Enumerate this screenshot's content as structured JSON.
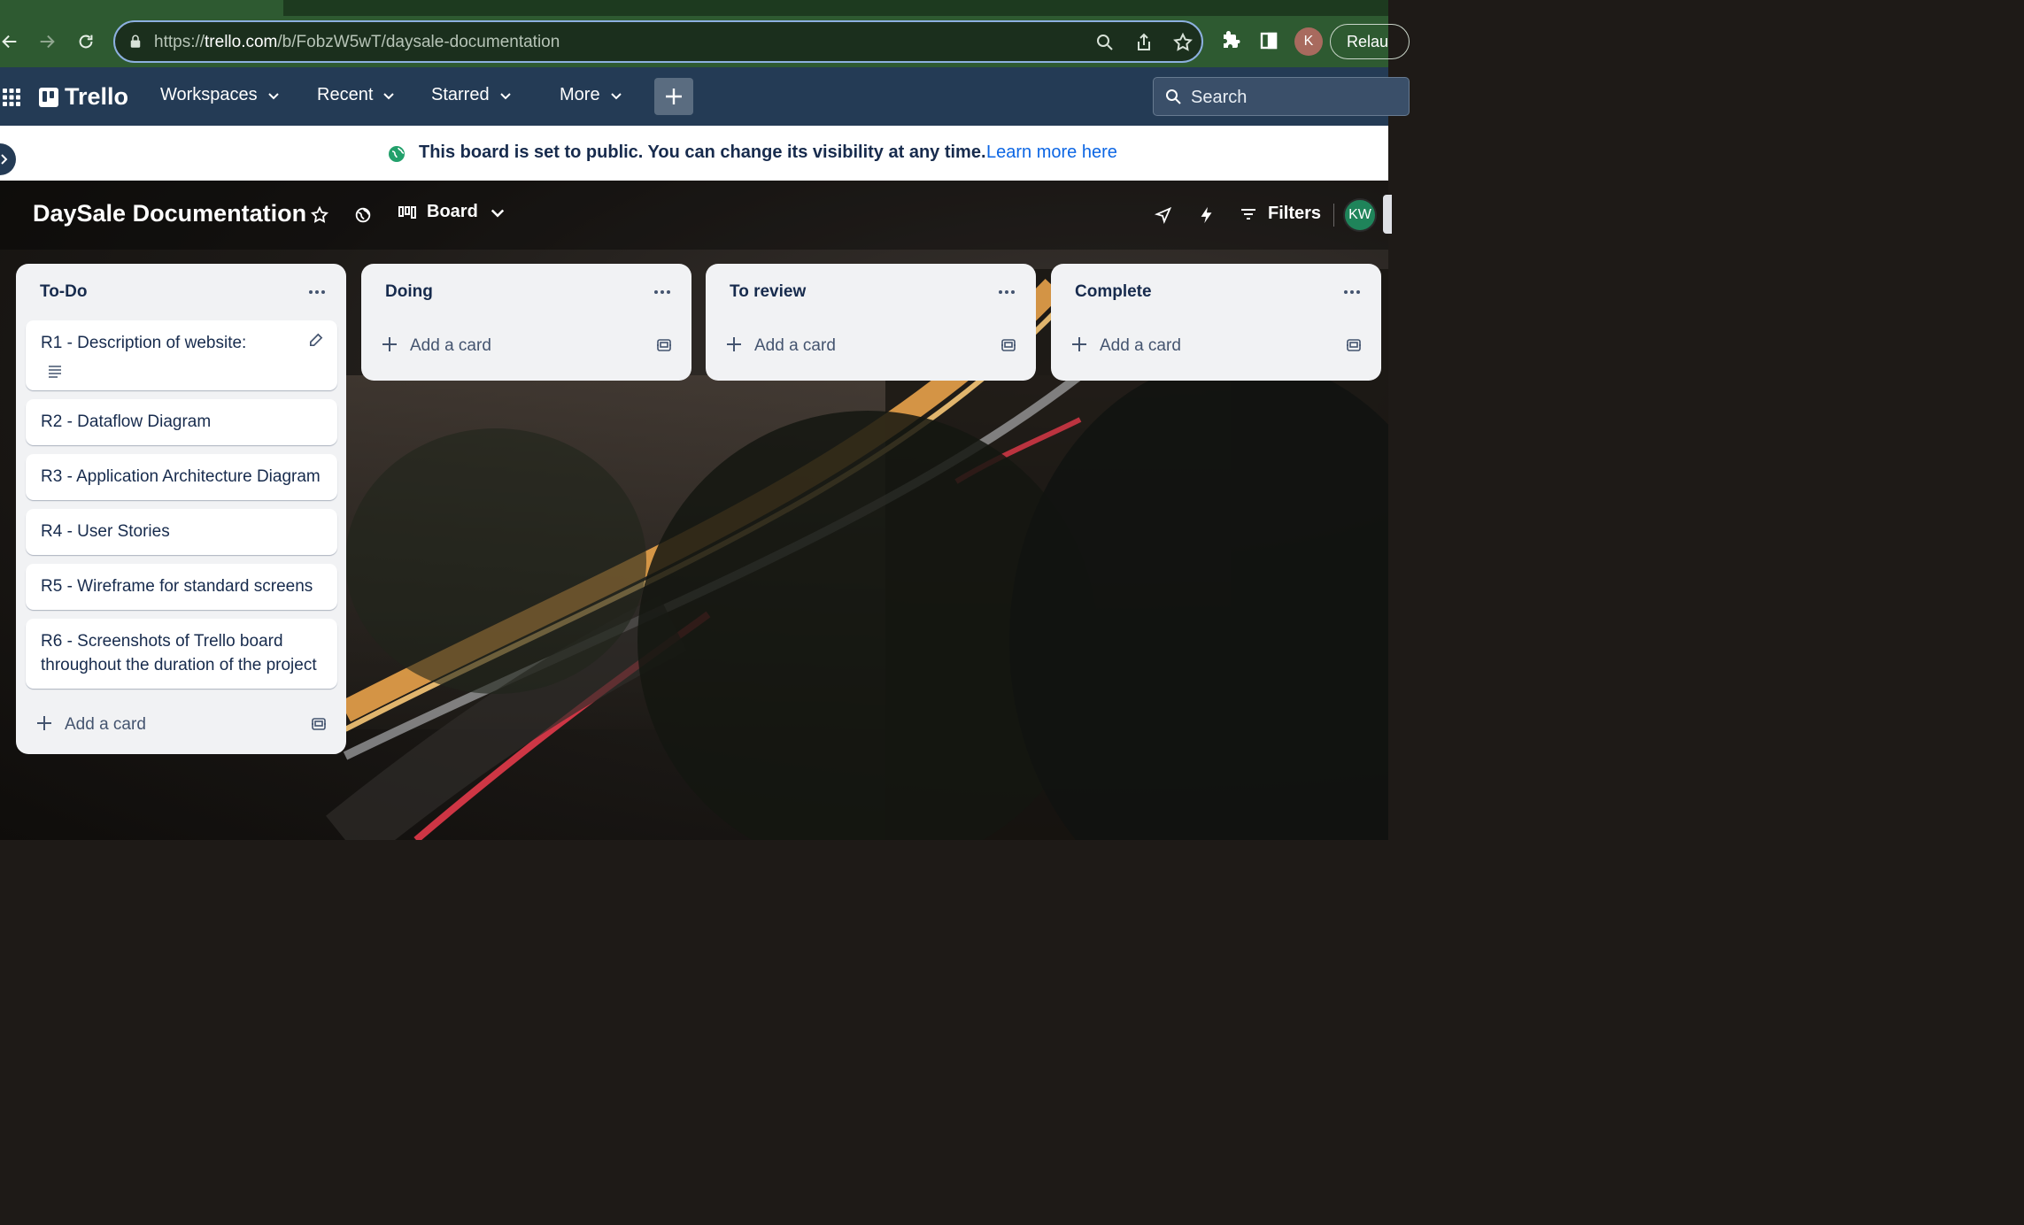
{
  "browser": {
    "url_prefix": "https://",
    "url_host": "trello.com",
    "url_path": "/b/FobzW5wT/daysale-documentation",
    "profile_initial": "K",
    "relaunch_label": "Relau"
  },
  "header": {
    "logo": "Trello",
    "menus": [
      "Workspaces",
      "Recent",
      "Starred",
      "More"
    ],
    "search_placeholder": "Search"
  },
  "banner": {
    "message": "This board is set to public. You can change its visibility at any time.",
    "link": "Learn more here"
  },
  "board": {
    "title": "DaySale Documentation",
    "view_label": "Board",
    "filters_label": "Filters",
    "member_initials": "KW"
  },
  "lists": [
    {
      "title": "To-Do",
      "cards": [
        "R1 - Description of website:",
        "R2 - Dataflow Diagram",
        "R3 - Application Architecture Diagram",
        "R4 - User Stories",
        "R5 - Wireframe for standard screens",
        "R6 - Screenshots of Trello board throughout the duration of the project"
      ],
      "add_label": "Add a card"
    },
    {
      "title": "Doing",
      "cards": [],
      "add_label": "Add a card"
    },
    {
      "title": "To review",
      "cards": [],
      "add_label": "Add a card"
    },
    {
      "title": "Complete",
      "cards": [],
      "add_label": "Add a card"
    }
  ],
  "colors": {
    "browser_green": "#2e5a31",
    "trello_header": "#243b55",
    "list_bg": "#f1f2f4",
    "link_blue": "#0c66e4",
    "member_green": "#1f845a"
  }
}
